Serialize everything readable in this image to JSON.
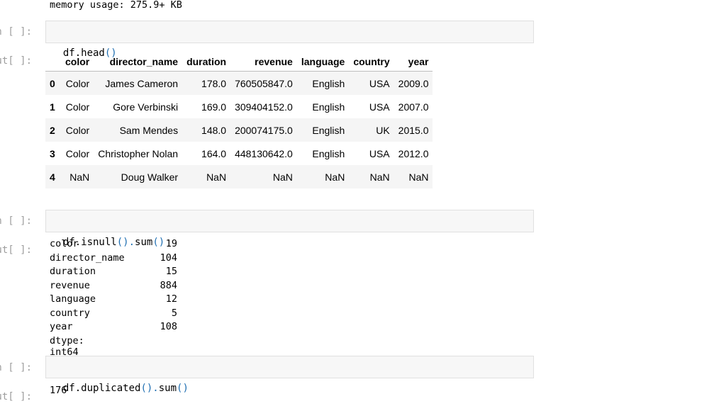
{
  "top_info": {
    "text": "memory usage: 275.9+ KB"
  },
  "cells": {
    "head": {
      "in_prompt": "In [ ]:",
      "out_prompt": "Out[ ]:",
      "code_obj": "df.head",
      "code_parens": "()"
    },
    "isnull": {
      "in_prompt": "In [ ]:",
      "out_prompt": "Out[ ]:",
      "code_a": "df.isnull",
      "code_b": "().",
      "code_c": "sum",
      "code_d": "()"
    },
    "duplicated": {
      "in_prompt": "In [ ]:",
      "out_prompt": "Out[ ]:",
      "code_a": "df.duplicated",
      "code_b": "().",
      "code_c": "sum",
      "code_d": "()",
      "output": "176"
    }
  },
  "head_table": {
    "columns": [
      "color",
      "director_name",
      "duration",
      "revenue",
      "language",
      "country",
      "year"
    ],
    "rows": [
      {
        "index": "0",
        "cells": [
          "Color",
          "James Cameron",
          "178.0",
          "760505847.0",
          "English",
          "USA",
          "2009.0"
        ]
      },
      {
        "index": "1",
        "cells": [
          "Color",
          "Gore Verbinski",
          "169.0",
          "309404152.0",
          "English",
          "USA",
          "2007.0"
        ]
      },
      {
        "index": "2",
        "cells": [
          "Color",
          "Sam Mendes",
          "148.0",
          "200074175.0",
          "English",
          "UK",
          "2015.0"
        ]
      },
      {
        "index": "3",
        "cells": [
          "Color",
          "Christopher Nolan",
          "164.0",
          "448130642.0",
          "English",
          "USA",
          "2012.0"
        ]
      },
      {
        "index": "4",
        "cells": [
          "NaN",
          "Doug Walker",
          "NaN",
          "NaN",
          "NaN",
          "NaN",
          "NaN"
        ]
      }
    ]
  },
  "null_counts": {
    "rows": [
      {
        "name": "color",
        "value": "19"
      },
      {
        "name": "director_name",
        "value": "104"
      },
      {
        "name": "duration",
        "value": "15"
      },
      {
        "name": "revenue",
        "value": "884"
      },
      {
        "name": "language",
        "value": "12"
      },
      {
        "name": "country",
        "value": "5"
      },
      {
        "name": "year",
        "value": "108"
      }
    ],
    "dtype": "dtype: int64"
  }
}
